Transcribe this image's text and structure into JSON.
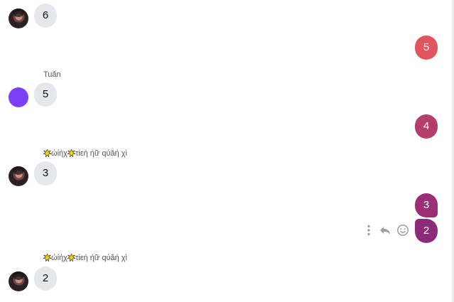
{
  "messages": {
    "m1": {
      "text": "6"
    },
    "m2": {
      "text": "5"
    },
    "m3": {
      "sender": "Tuấn",
      "text": "5"
    },
    "m4": {
      "text": "4"
    },
    "m5": {
      "sender": "ώίήχτίεή ήữ qύăή χὶ",
      "text": "3"
    },
    "m6": {
      "text": "3"
    },
    "m7": {
      "text": "2"
    },
    "m8": {
      "sender": "ώίήχτίεή ήữ qύăή χὶ",
      "text": "2"
    }
  },
  "sender_styled": {
    "part1": "ώίήχ",
    "part2": "τίεή ήữ qύăή χὶ"
  },
  "actions": {
    "more_icon": "more-vertical-icon",
    "reply_icon": "reply-icon",
    "emoji_icon": "emoji-icon"
  },
  "colors": {
    "incoming_bubble": "#e6e7ec",
    "outgoing_gradient_top": "#e2555c",
    "outgoing_mid": "#b53d6b",
    "outgoing_bottom": "#8e2b78",
    "avatar_purple": "#7b3ff5"
  }
}
